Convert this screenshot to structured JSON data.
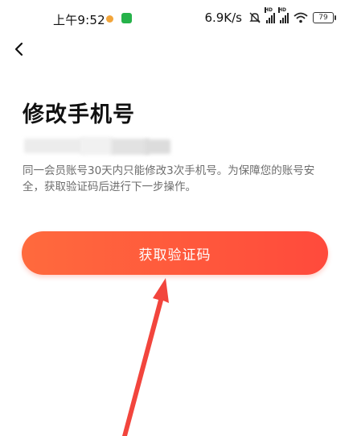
{
  "status_bar": {
    "time": "上午9:52",
    "net_speed": "6.9K/s",
    "battery": "79",
    "signal_label": "HD"
  },
  "header": {
    "back_icon": "chevron-left-icon"
  },
  "page": {
    "title": "修改手机号",
    "notice": "同一会员账号30天内只能修改3次手机号。为保障您的账号安全，获取验证码后进行下一步操作。"
  },
  "actions": {
    "get_code_label": "获取验证码"
  },
  "colors": {
    "button_start": "#ff6a3d",
    "button_end": "#ff4a3c",
    "arrow": "#f2453d"
  }
}
